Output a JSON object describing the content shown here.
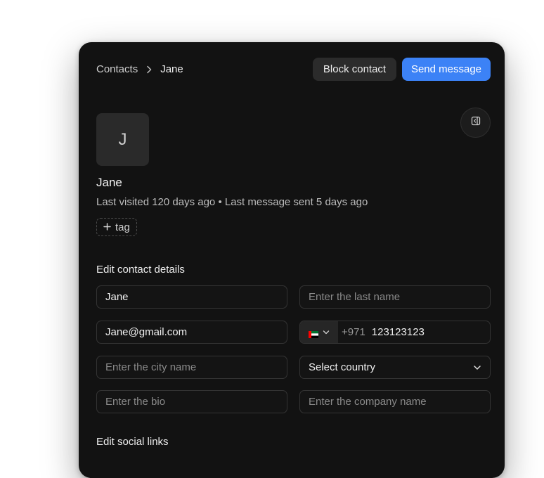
{
  "breadcrumb": {
    "root": "Contacts",
    "current": "Jane"
  },
  "actions": {
    "block_label": "Block contact",
    "send_label": "Send message"
  },
  "contact": {
    "initial": "J",
    "name": "Jane",
    "meta": "Last visited 120 days ago • Last message sent 5 days ago",
    "tag_label": "tag"
  },
  "form": {
    "title": "Edit contact details",
    "first_name": {
      "value": "Jane",
      "placeholder": ""
    },
    "last_name": {
      "value": "",
      "placeholder": "Enter the last name"
    },
    "email": {
      "value": "Jane@gmail.com",
      "placeholder": ""
    },
    "phone": {
      "country_flag": "uae-flag-icon",
      "dial_code": "+971",
      "value": "123123123"
    },
    "city": {
      "value": "",
      "placeholder": "Enter the city name"
    },
    "country": {
      "selected": "Select country"
    },
    "bio": {
      "value": "",
      "placeholder": "Enter the bio"
    },
    "company": {
      "value": "",
      "placeholder": "Enter the company name"
    }
  },
  "social": {
    "title": "Edit social links"
  },
  "colors": {
    "panel_bg": "#121212",
    "accent": "#3c82f6",
    "button_secondary": "#2b2b2b"
  },
  "icons": {
    "breadcrumb_separator": "chevron-right-icon",
    "panel_toggle": "sidebar-collapse-icon",
    "tag": "plus-icon",
    "select": "chevron-down-icon"
  }
}
